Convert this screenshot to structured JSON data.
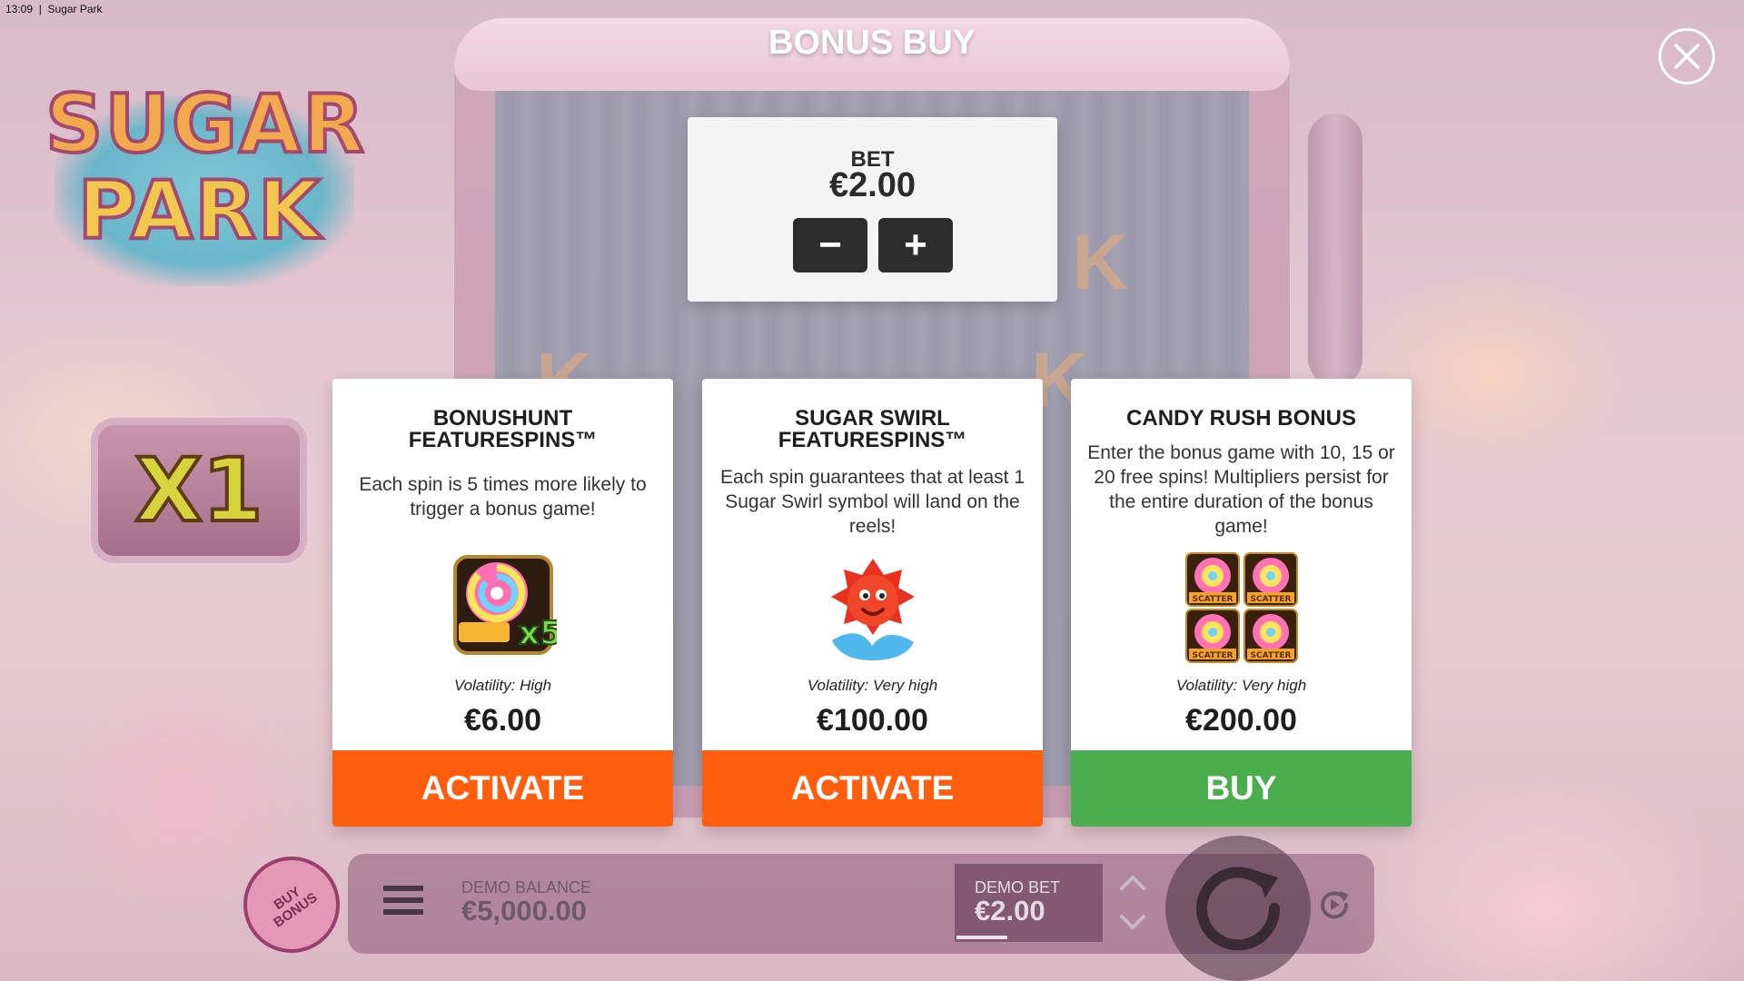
{
  "status_bar": {
    "time": "13:09",
    "app": "Sugar Park"
  },
  "logo": {
    "line1": "SUGAR",
    "line2": "PARK"
  },
  "multiplier": "X1",
  "dialog": {
    "title": "BONUS BUY",
    "bet": {
      "label": "BET",
      "value": "€2.00",
      "decrease": "−",
      "increase": "+"
    }
  },
  "cards": [
    {
      "title": "BONUSHUNT\nFEATURESPINS™",
      "description": "Each spin is 5 times more likely to trigger a bonus game!",
      "image": "scatter-x5-icon",
      "image_text": "x5",
      "volatility": "Volatility: High",
      "price": "€6.00",
      "action": "ACTIVATE",
      "action_color": "#ff5e0e"
    },
    {
      "title": "SUGAR SWIRL\nFEATURESPINS™",
      "description": "Each spin guarantees that at least 1 Sugar Swirl symbol will land on the reels!",
      "image": "sugar-swirl-icon",
      "volatility": "Volatility: Very high",
      "price": "€100.00",
      "action": "ACTIVATE",
      "action_color": "#ff5e0e"
    },
    {
      "title": "CANDY RUSH BONUS",
      "description": "Enter the bonus game with 10, 15 or 20 free spins! Multipliers persist for the entire duration of the bonus game!",
      "image": "four-scatters-icon",
      "image_text": "SCATTER",
      "volatility": "Volatility: Very high",
      "price": "€200.00",
      "action": "BUY",
      "action_color": "#4aae4f"
    }
  ],
  "bottom_bar": {
    "buy_bonus": "BUY\nBONUS",
    "balance_label": "DEMO BALANCE",
    "balance_value": "€5,000.00",
    "bet_label": "DEMO BET",
    "bet_value": "€2.00"
  }
}
